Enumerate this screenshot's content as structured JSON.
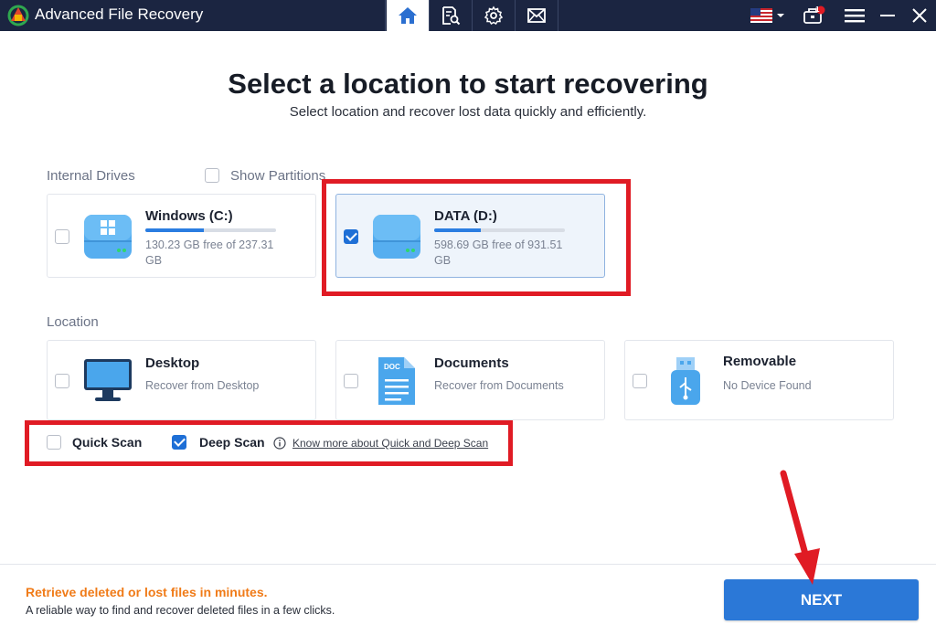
{
  "app": {
    "title": "Advanced File Recovery"
  },
  "titlebar": {
    "tabs": [
      {
        "name": "home",
        "icon": "home-icon",
        "active": true
      },
      {
        "name": "scan-log",
        "icon": "document-search-icon",
        "active": false
      },
      {
        "name": "settings",
        "icon": "gear-icon",
        "active": false
      },
      {
        "name": "mail",
        "icon": "mail-icon",
        "active": false
      }
    ],
    "notification_count": "1",
    "language_icon": "us-flag-icon"
  },
  "header": {
    "title": "Select a location to start recovering",
    "subtitle": "Select location and recover lost data quickly and efficiently."
  },
  "internal_drives": {
    "label": "Internal Drives",
    "show_partitions_label": "Show Partitions",
    "show_partitions_checked": false,
    "drives": [
      {
        "name": "Windows (C:)",
        "free_text": "130.23 GB free of 237.31",
        "unit_line": "GB",
        "used_fraction": 0.45,
        "checked": false
      },
      {
        "name": "DATA (D:)",
        "free_text": "598.69 GB free of 931.51",
        "unit_line": "GB",
        "used_fraction": 0.36,
        "checked": true
      }
    ]
  },
  "location": {
    "label": "Location",
    "items": [
      {
        "name": "Desktop",
        "sub": "Recover from Desktop",
        "icon": "monitor-icon",
        "checked": false
      },
      {
        "name": "Documents",
        "sub": "Recover from Documents",
        "icon": "document-icon",
        "checked": false
      },
      {
        "name": "Removable",
        "sub": "No Device Found",
        "icon": "usb-drive-icon",
        "checked": false
      }
    ],
    "doc_badge": "DOC"
  },
  "scan": {
    "quick_label": "Quick Scan",
    "quick_checked": false,
    "deep_label": "Deep Scan",
    "deep_checked": true,
    "info_link": "Know more about Quick and Deep Scan"
  },
  "footer": {
    "title": "Retrieve deleted or lost files in minutes.",
    "subtitle": "A reliable way to find and recover deleted files in a few clicks.",
    "next_label": "NEXT"
  },
  "colors": {
    "titlebar": "#1b2541",
    "accent": "#2b78d7",
    "highlight_box": "#e01b24",
    "footer_title": "#f07b18"
  }
}
